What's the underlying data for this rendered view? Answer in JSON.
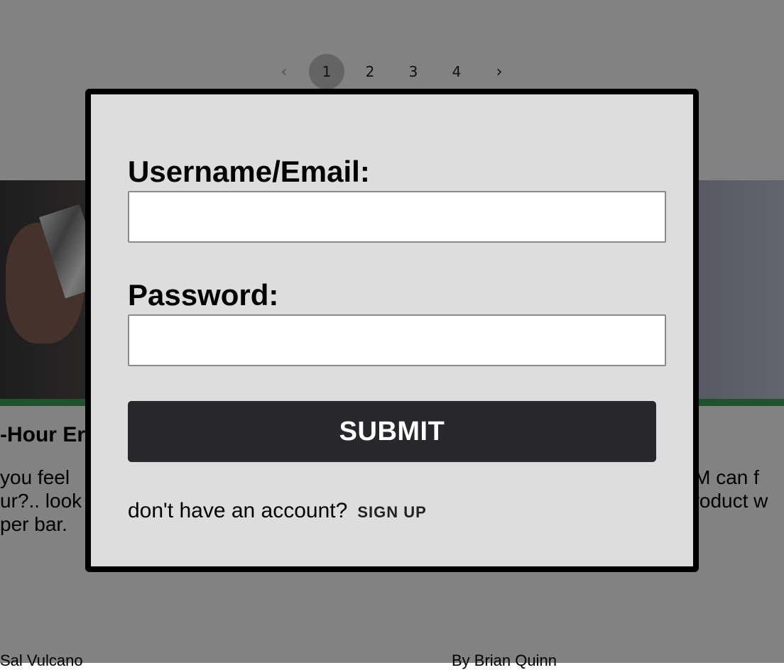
{
  "pagination": {
    "prev_icon": "chevron-left-icon",
    "next_icon": "chevron-right-icon",
    "prev_glyph": "‹",
    "next_glyph": "›",
    "pages": [
      "1",
      "2",
      "3",
      "4"
    ],
    "current": "1"
  },
  "cards": {
    "left": {
      "title": "-Hour Er",
      "excerpt": " you feel\nur?.. look\nper bar.",
      "author": "Sal Vulcano"
    },
    "right": {
      "excerpt": "TM can f\nproduct w",
      "author": "By Brian Quinn"
    }
  },
  "colors": {
    "overlay": "#000000",
    "modal_background": "#dddddd",
    "submit_background": "#28282c",
    "accent_green": "#3aa655"
  },
  "login_modal": {
    "username_label": "Username/Email:",
    "username_value": "",
    "password_label": "Password:",
    "password_value": "",
    "submit_label": "SUBMIT",
    "signup_prompt": "don't have an account?",
    "signup_link": "SIGN UP"
  }
}
